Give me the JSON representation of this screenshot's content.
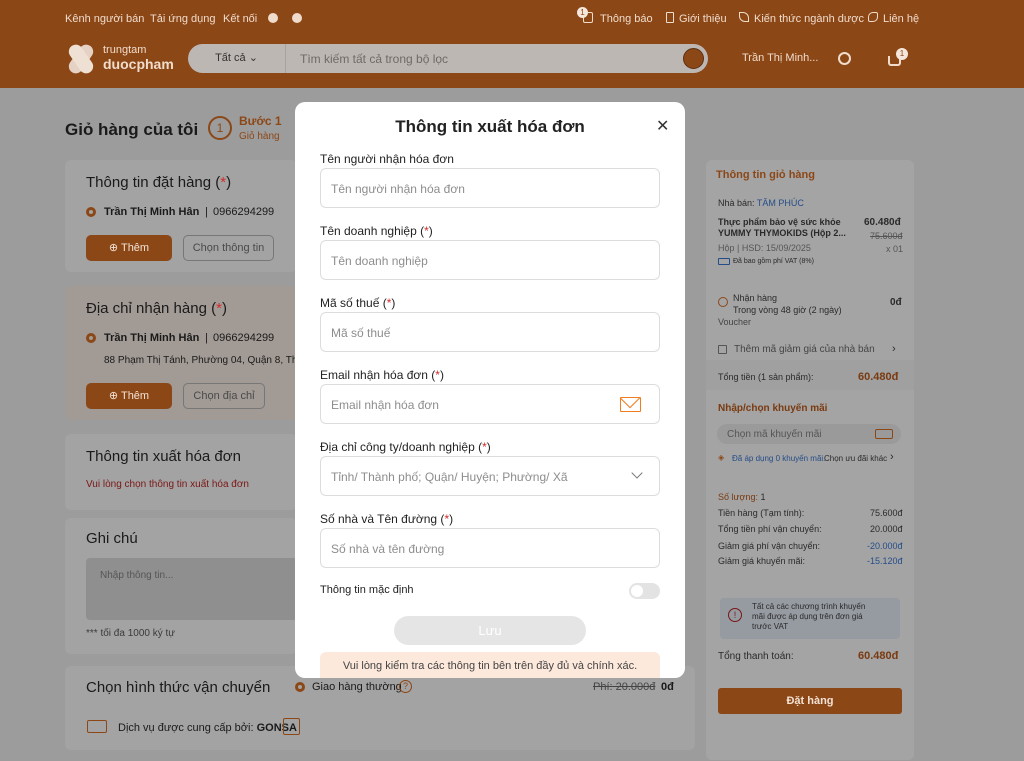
{
  "topnav": {
    "left_links": [
      "Kênh người bán",
      "Tải ứng dụng",
      "Kết nối"
    ],
    "right_links": [
      "Thông báo",
      "Giới thiệu",
      "Kiến thức ngành dược",
      "Liên hệ"
    ],
    "notif_count": "1"
  },
  "logo": {
    "line1": "trungtam",
    "line2": "duocpham"
  },
  "search": {
    "category": "Tất cả",
    "placeholder": "Tìm kiếm tất cả trong bộ lọc"
  },
  "user": {
    "name": "Trần Thị Minh...",
    "cart_count": "1"
  },
  "page": {
    "title": "Giỏ hàng của tôi",
    "step_no": "1",
    "step_label": "Bước 1",
    "step_sub": "Giỏ hàng"
  },
  "order_info": {
    "title": "Thông tin đặt hàng",
    "name": "Trần Thị Minh Hân",
    "phone": "0966294299",
    "add": "Thêm",
    "choose": "Chọn thông tin"
  },
  "address": {
    "title": "Địa chỉ nhận hàng",
    "name": "Trần Thị Minh Hân",
    "phone": "0966294299",
    "line": "88 Phạm Thị Tánh, Phường 04, Quận 8, Thà",
    "add": "Thêm",
    "choose": "Chọn địa chỉ"
  },
  "invoice_card": {
    "title": "Thông tin xuất hóa đơn",
    "warn": "Vui lòng chọn thông tin xuất hóa đơn"
  },
  "note": {
    "title": "Ghi chú",
    "placeholder": "Nhập thông tin...",
    "limit": "*** tối đa 1000 ký tự"
  },
  "shipping": {
    "title": "Chọn hình thức vận chuyển",
    "option": "Giao hàng thường",
    "fee_old": "Phí: 20.000đ",
    "fee": "0đ",
    "provider_label": "Dịch vụ được cung cấp bởi:",
    "provider": "GONSA"
  },
  "sidebar": {
    "title": "Thông tin giỏ hàng",
    "seller_label": "Nhà bán:",
    "seller": "TÂM PHÚC",
    "product_line1": "Thực phẩm bảo vệ sức khỏe",
    "product_line2": "YUMMY THYMOKIDS (Hộp 2...",
    "price": "60.480đ",
    "old_price": "75.600đ",
    "unit": "Hộp | HSD: 15/09/2025",
    "qty": "x 01",
    "vat": "Đã bao gồm phí VAT (8%)",
    "delivery_label": "Nhận hàng",
    "delivery_time": "Trong vòng 48 giờ (2 ngày)",
    "delivery_fee": "0đ",
    "voucher": "Voucher",
    "add_coupon": "Thêm mã giảm giá của nhà bán",
    "total_label": "Tổng tiền (1 sản phẩm):",
    "total": "60.480đ",
    "promo_title": "Nhập/chọn khuyến mãi",
    "promo_placeholder": "Chọn mã khuyến mãi",
    "promo_applied": "Đã áp dụng 0 khuyến mãi.",
    "promo_choose": "Chọn ưu đãi khác",
    "qty_label": "Số lượng:",
    "qty_value": "1",
    "rows": [
      {
        "label": "Tiền hàng (Tạm tính):",
        "value": "75.600đ"
      },
      {
        "label": "Tổng tiền phí vận chuyển:",
        "value": "20.000đ"
      },
      {
        "label": "Giảm giá phí vận chuyển:",
        "value": "-20.000đ"
      },
      {
        "label": "Giảm giá khuyến mãi:",
        "value": "-15.120đ"
      }
    ],
    "info_line1": "Tất cả các chương trình khuyến",
    "info_line2": "mãi được áp dụng trên đơn giá",
    "info_line3": "trước VAT",
    "pay_label": "Tổng thanh toán:",
    "pay": "60.480đ",
    "order_btn": "Đặt hàng"
  },
  "modal": {
    "title": "Thông tin xuất hóa đơn",
    "close": "✕",
    "fields": [
      {
        "label": "Tên người nhận hóa đơn",
        "required": false,
        "placeholder": "Tên người nhận hóa đơn"
      },
      {
        "label": "Tên doanh nghiệp",
        "required": true,
        "placeholder": "Tên doanh nghiệp"
      },
      {
        "label": "Mã số thuế",
        "required": true,
        "placeholder": "Mã số thuế"
      },
      {
        "label": "Email nhận hóa đơn",
        "required": true,
        "placeholder": "Email nhận hóa đơn"
      },
      {
        "label": "Địa chỉ công ty/doanh nghiệp",
        "required": true,
        "placeholder": "Tỉnh/ Thành phố; Quận/ Huyện; Phường/ Xã"
      },
      {
        "label": "Số nhà và Tên đường",
        "required": true,
        "placeholder": "Số nhà và tên đường"
      }
    ],
    "req_open": " (",
    "req_star": "*",
    "req_close": ")",
    "default_label": "Thông tin mặc định",
    "save": "Lưu",
    "notice": "Vui lòng kiểm tra các thông tin bên trên đầy đủ và chính xác."
  },
  "colors": {
    "brand": "#f07d22",
    "overlay_brand": "#8c4717",
    "danger": "#d32b2b"
  }
}
